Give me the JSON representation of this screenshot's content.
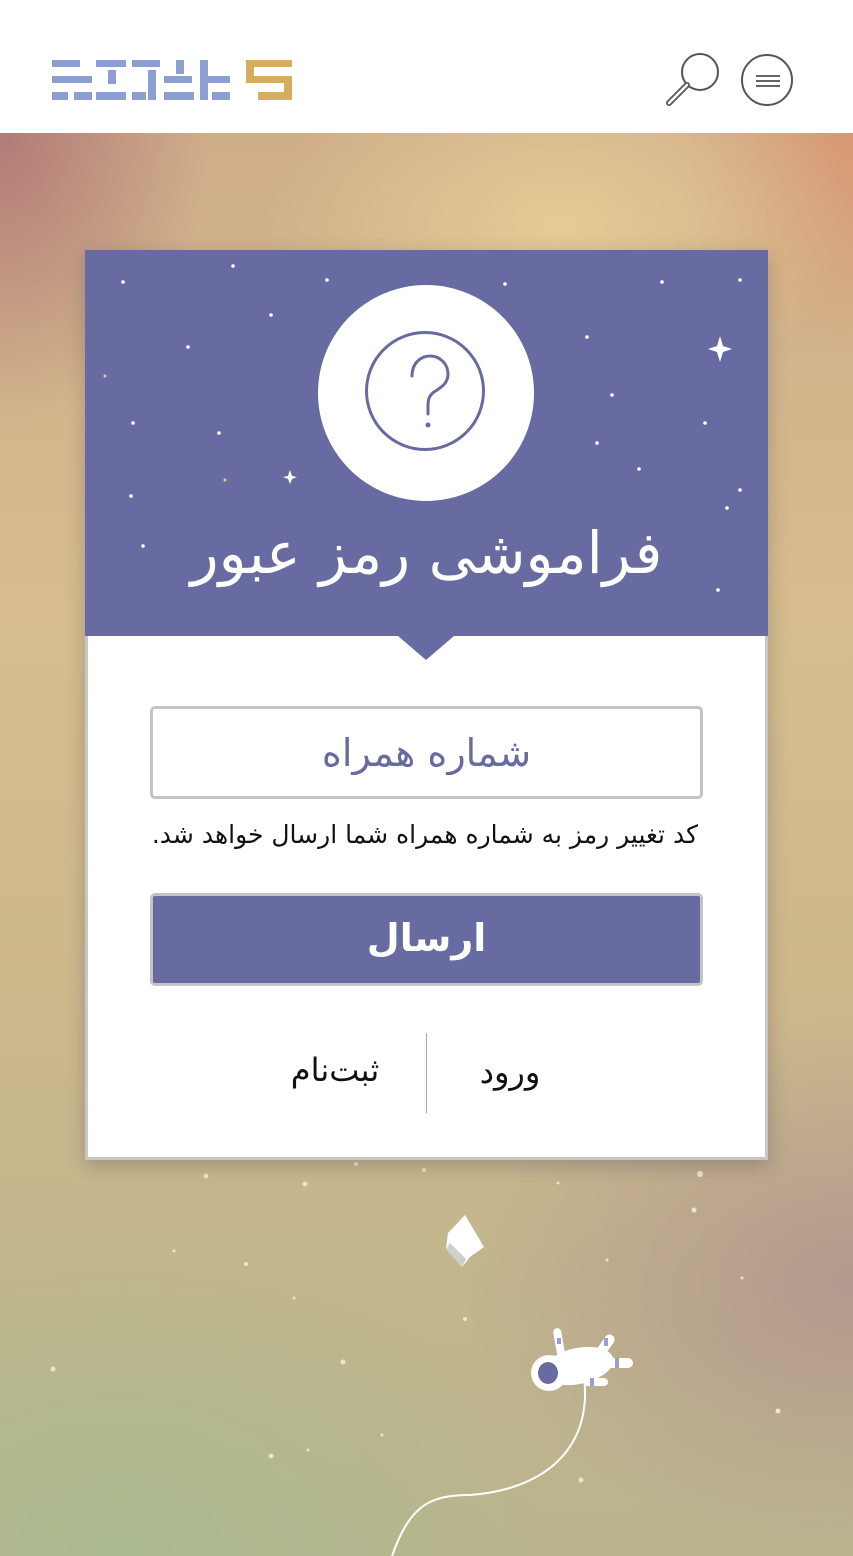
{
  "header": {
    "logo_icon": "brand-logo",
    "search_icon": "search-icon",
    "menu_icon": "hamburger-menu-icon"
  },
  "card": {
    "title": "فراموشی رمز عبور",
    "question_icon": "question-mark-icon",
    "phone_input": {
      "value": "",
      "placeholder": "شماره همراه"
    },
    "hint": "کد تغییر رمز به شماره همراه شما ارسال خواهد شد.",
    "send_label": "ارسال",
    "login_label": "ورود",
    "signup_label": "ثبت‌نام"
  },
  "colors": {
    "accent": "#686ba1",
    "logo_blue": "#8b9fd3",
    "logo_gold": "#d4ad63"
  }
}
